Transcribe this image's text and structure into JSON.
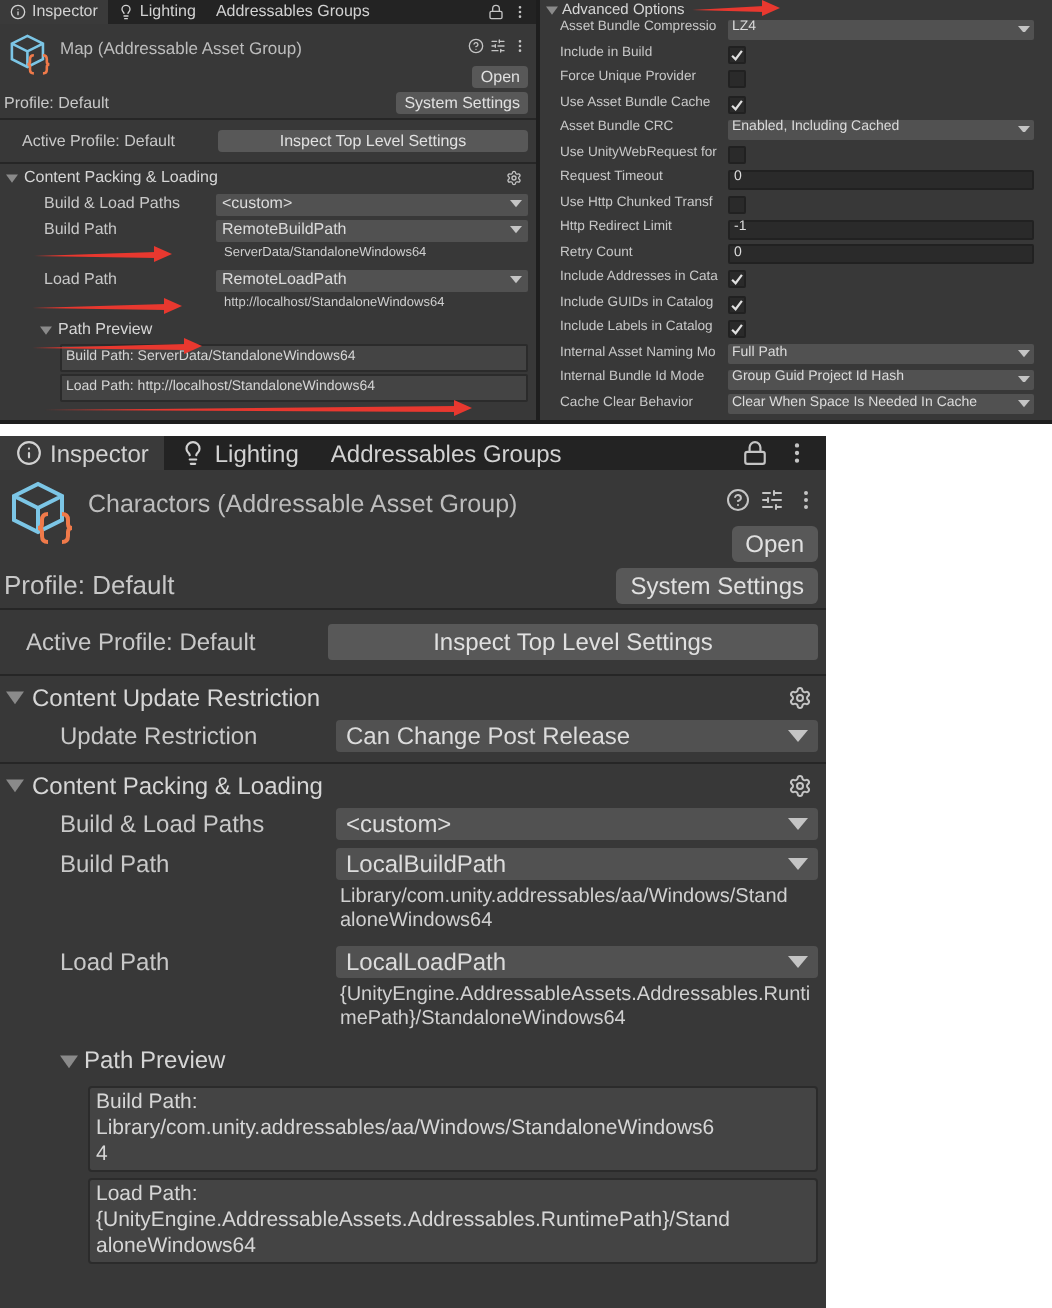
{
  "inspector_small": {
    "tabs": [
      {
        "label": "Inspector",
        "selected": true
      },
      {
        "label": "Lighting",
        "selected": false
      },
      {
        "label": "Addressables Groups",
        "selected": false
      }
    ],
    "title": "Map (Addressable Asset Group)",
    "open_button": "Open",
    "profile": "Profile: Default",
    "system_settings_button": "System Settings",
    "active_profile": "Active Profile: Default",
    "inspect_button": "Inspect Top Level Settings",
    "sections": [
      {
        "title": "Content Packing & Loading",
        "expanded": true,
        "fields": [
          {
            "label": "Build & Load Paths",
            "kind": "dropdown",
            "value": "<custom>"
          },
          {
            "label": "Build Path",
            "kind": "dropdown",
            "value": "RemoteBuildPath",
            "path_lines": [
              "ServerData/StandaloneWindows64"
            ]
          },
          {
            "label": "Load Path",
            "kind": "dropdown",
            "value": "RemoteLoadPath",
            "path_lines": [
              "http://localhost/StandaloneWindows64"
            ]
          }
        ],
        "path_preview": {
          "title": "Path Preview",
          "expanded": true,
          "boxes": [
            [
              "Build Path: ServerData/StandaloneWindows64"
            ],
            [
              "Load Path: http://localhost/StandaloneWindows64"
            ]
          ]
        }
      }
    ]
  },
  "advanced_options": {
    "title": "Advanced Options",
    "expanded": true,
    "fields": [
      {
        "label": "Asset Bundle Compressio",
        "kind": "dropdown",
        "value": "LZ4"
      },
      {
        "label": "Include in Build",
        "kind": "checkbox",
        "checked": true
      },
      {
        "label": "Force Unique Provider",
        "kind": "checkbox",
        "checked": false
      },
      {
        "label": "Use Asset Bundle Cache",
        "kind": "checkbox",
        "checked": true
      },
      {
        "label": "Asset Bundle CRC",
        "kind": "dropdown",
        "value": "Enabled, Including Cached"
      },
      {
        "label": "Use UnityWebRequest for",
        "kind": "checkbox",
        "checked": false
      },
      {
        "label": "Request Timeout",
        "kind": "number",
        "value": "0"
      },
      {
        "label": "Use Http Chunked Transf",
        "kind": "checkbox",
        "checked": false
      },
      {
        "label": "Http Redirect Limit",
        "kind": "number",
        "value": "-1"
      },
      {
        "label": "Retry Count",
        "kind": "number",
        "value": "0"
      },
      {
        "label": "Include Addresses in Cata",
        "kind": "checkbox",
        "checked": true
      },
      {
        "label": "Include GUIDs in Catalog",
        "kind": "checkbox",
        "checked": true
      },
      {
        "label": "Include Labels in Catalog",
        "kind": "checkbox",
        "checked": true
      },
      {
        "label": "Internal Asset Naming Mo",
        "kind": "dropdown",
        "value": "Full Path"
      },
      {
        "label": "Internal Bundle Id Mode",
        "kind": "dropdown",
        "value": "Group Guid Project Id Hash"
      },
      {
        "label": "Cache Clear Behavior",
        "kind": "dropdown",
        "value": "Clear When Space Is Needed In Cache"
      }
    ]
  },
  "inspector_large": {
    "tabs": [
      {
        "label": "Inspector",
        "selected": true
      },
      {
        "label": "Lighting",
        "selected": false
      },
      {
        "label": "Addressables Groups",
        "selected": false
      }
    ],
    "title": "Charactors (Addressable Asset Group)",
    "open_button": "Open",
    "profile": "Profile: Default",
    "system_settings_button": "System Settings",
    "active_profile": "Active Profile: Default",
    "inspect_button": "Inspect Top Level Settings",
    "sections": [
      {
        "title": "Content Update Restriction",
        "expanded": true,
        "fields": [
          {
            "label": "Update Restriction",
            "kind": "dropdown",
            "value": "Can Change Post Release"
          }
        ]
      },
      {
        "title": "Content Packing & Loading",
        "expanded": true,
        "fields": [
          {
            "label": "Build & Load Paths",
            "kind": "dropdown",
            "value": "<custom>"
          },
          {
            "label": "Build Path",
            "kind": "dropdown",
            "value": "LocalBuildPath",
            "path_lines": [
              "Library/com.unity.addressables/aa/Windows/Stand",
              "aloneWindows64"
            ]
          },
          {
            "label": "Load Path",
            "kind": "dropdown",
            "value": "LocalLoadPath",
            "path_lines": [
              "{UnityEngine.AddressableAssets.Addressables.Runti",
              "mePath}/StandaloneWindows64"
            ]
          }
        ],
        "path_preview": {
          "title": "Path Preview",
          "expanded": true,
          "boxes": [
            [
              "Build Path:",
              "Library/com.unity.addressables/aa/Windows/StandaloneWindows6",
              "4"
            ],
            [
              "Load Path:",
              "{UnityEngine.AddressableAssets.Addressables.RuntimePath}/Stand",
              "aloneWindows64"
            ]
          ]
        }
      }
    ]
  }
}
